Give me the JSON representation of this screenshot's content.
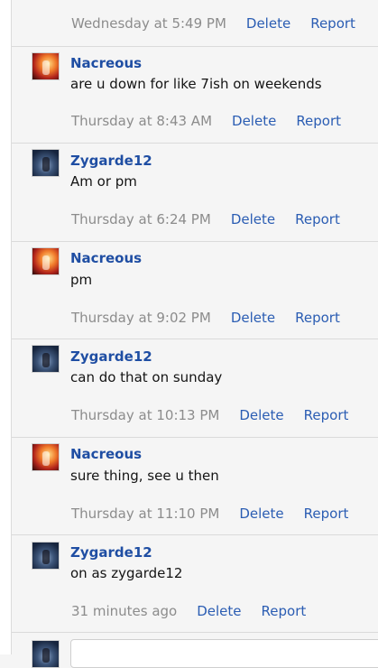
{
  "messages": [
    {
      "time": "Wednesday at 5:49 PM",
      "delete": "Delete",
      "report": "Report"
    },
    {
      "author": "Nacreous",
      "avatar_icon": "nacreous-avatar",
      "text": "are u down for like 7ish on weekends",
      "time": "Thursday at 8:43 AM",
      "delete": "Delete",
      "report": "Report"
    },
    {
      "author": "Zygarde12",
      "avatar_icon": "zygarde12-avatar",
      "text": "Am or pm",
      "time": "Thursday at 6:24 PM",
      "delete": "Delete",
      "report": "Report"
    },
    {
      "author": "Nacreous",
      "avatar_icon": "nacreous-avatar",
      "text": "pm",
      "time": "Thursday at 9:02 PM",
      "delete": "Delete",
      "report": "Report"
    },
    {
      "author": "Zygarde12",
      "avatar_icon": "zygarde12-avatar",
      "text": "can do that on sunday",
      "time": "Thursday at 10:13 PM",
      "delete": "Delete",
      "report": "Report"
    },
    {
      "author": "Nacreous",
      "avatar_icon": "nacreous-avatar",
      "text": "sure thing, see u then",
      "time": "Thursday at 11:10 PM",
      "delete": "Delete",
      "report": "Report"
    },
    {
      "author": "Zygarde12",
      "avatar_icon": "zygarde12-avatar",
      "text": "on as zygarde12",
      "time": "31 minutes ago",
      "delete": "Delete",
      "report": "Report"
    }
  ],
  "reply": {
    "avatar_icon": "zygarde12-avatar"
  },
  "colors": {
    "author": "#1f4ea3",
    "link": "#2b5db3",
    "timestamp": "#8c8c8c",
    "background": "#f5f5f5"
  }
}
